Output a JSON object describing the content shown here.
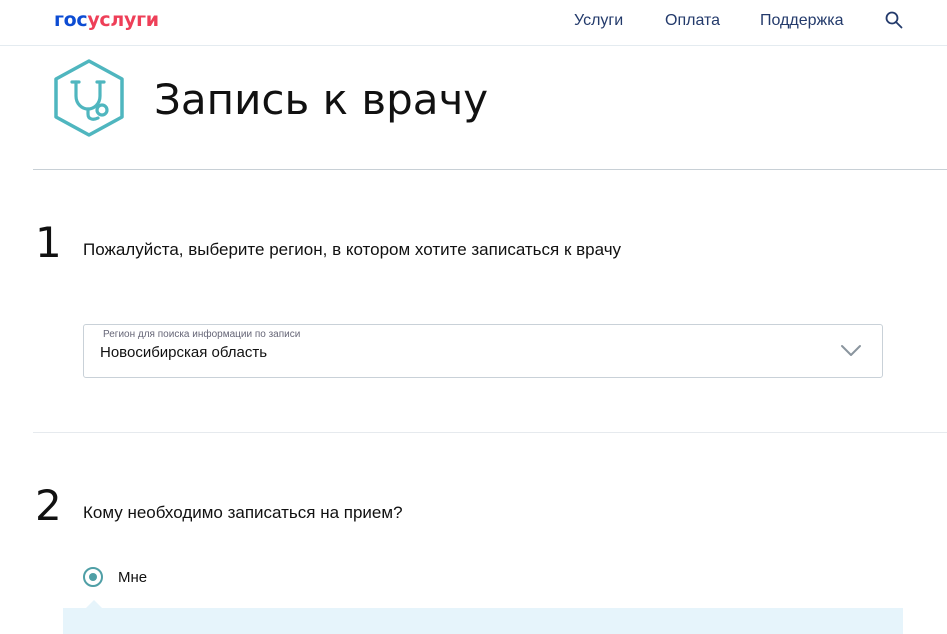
{
  "header": {
    "logo_part1": "гос",
    "logo_part2": "услуги",
    "nav": {
      "services": "Услуги",
      "payment": "Оплата",
      "support": "Поддержка"
    }
  },
  "page": {
    "title": "Запись к врачу",
    "icon": "stethoscope-icon"
  },
  "steps": [
    {
      "number": "1",
      "question": "Пожалуйста, выберите регион, в котором хотите записаться к врачу",
      "select": {
        "label": "Регион для поиска информации по записи",
        "value": "Новосибирская область"
      }
    },
    {
      "number": "2",
      "question": "Кому необходимо записаться на прием?",
      "radio": {
        "label": "Мне",
        "checked": true
      }
    }
  ],
  "colors": {
    "brand_blue": "#0d4cd3",
    "brand_red": "#ee3f58",
    "accent_teal": "#4f9fa6",
    "info_panel": "#e6f4fb"
  }
}
